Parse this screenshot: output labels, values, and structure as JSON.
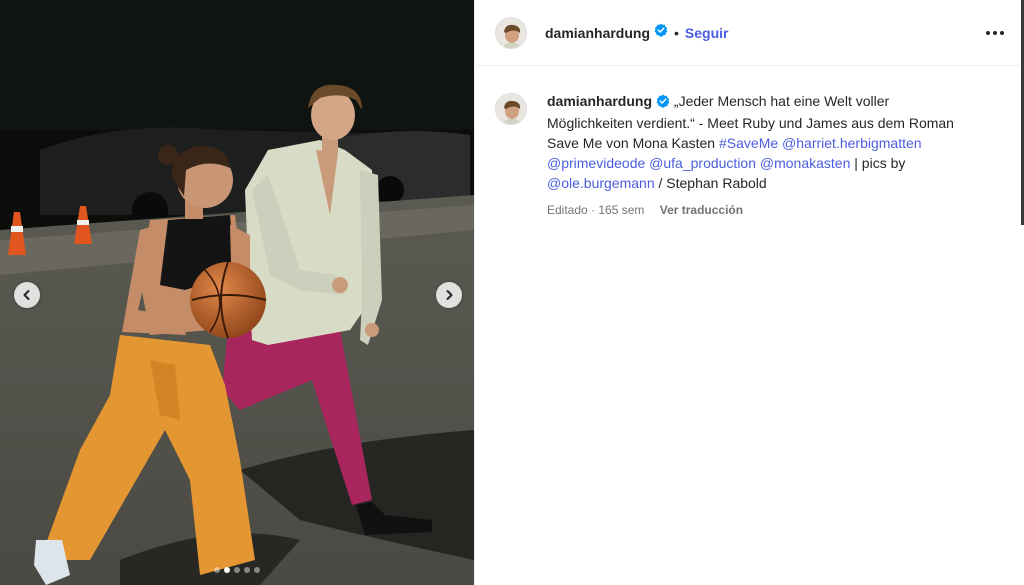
{
  "post": {
    "username": "damianhardung",
    "follow_label": "Seguir",
    "separator": "•",
    "verified_icon": "verified-badge-icon",
    "more_icon": "more-options-icon"
  },
  "caption": {
    "text_1": "„Jeder Mensch hat eine Welt voller Möglichkeiten verdient.“ - Meet Ruby und James aus dem Roman Save Me von Mona Kasten ",
    "hashtag": "#SaveMe",
    "mention_1": "@harriet.herbigmatten",
    "mention_2": "@primevideode",
    "mention_3": "@ufa_production",
    "mention_4": "@monakasten",
    "text_2": " | pics by ",
    "mention_5": "@ole.burgemann",
    "text_3": " / Stephan Rabold"
  },
  "meta": {
    "edited": "Editado · 165 sem",
    "translate_label": "Ver traducción"
  },
  "carousel": {
    "slide_count": 5,
    "active_index": 1,
    "prev_icon": "chevron-left-icon",
    "next_icon": "chevron-right-icon"
  },
  "colors": {
    "link": "#4a5ee0",
    "verified": "#0095f6",
    "muted": "#737373",
    "text": "#262626"
  }
}
